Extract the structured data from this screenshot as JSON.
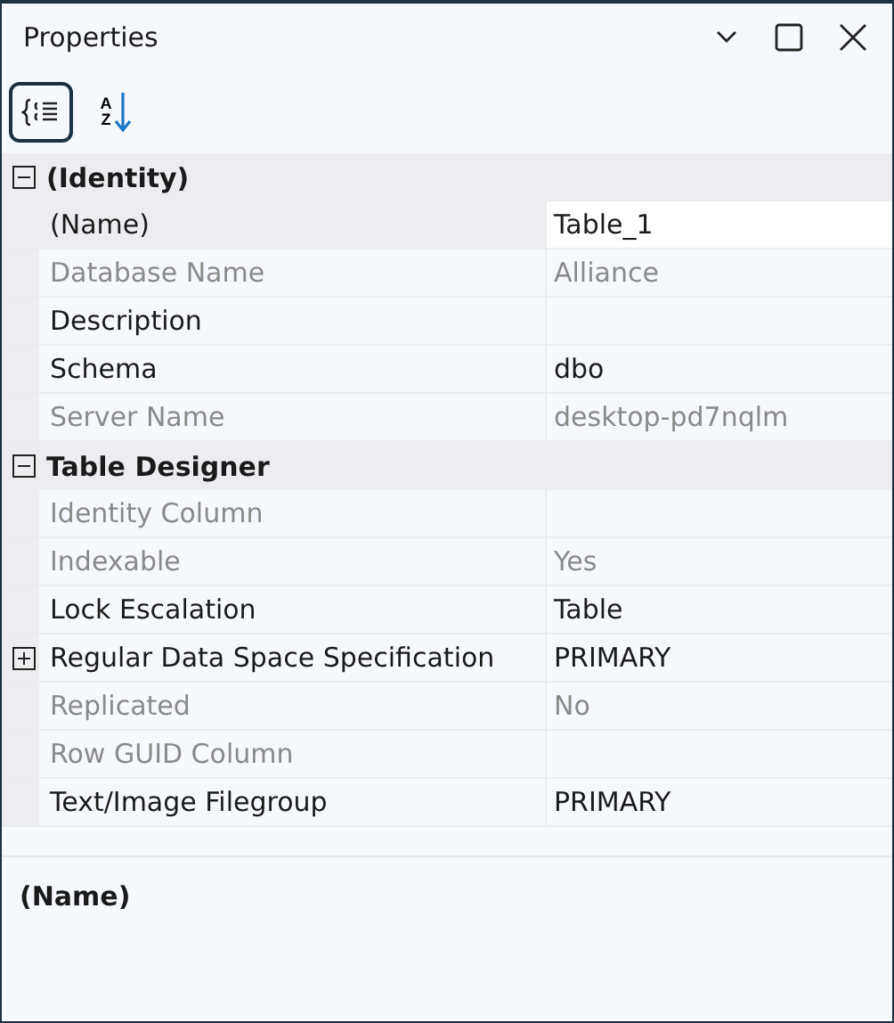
{
  "window": {
    "title": "Properties"
  },
  "toolbar": [
    {
      "kind": "categorized",
      "selected": true
    },
    {
      "kind": "alphabetical",
      "selected": false,
      "letters": [
        "A",
        "Z"
      ]
    }
  ],
  "categories": [
    {
      "name": "(Identity)",
      "expanded": true,
      "properties": [
        {
          "kind": "plain",
          "name": "(Name)",
          "value": "Table_1",
          "disabled": false,
          "selected": true
        },
        {
          "kind": "plain",
          "name": "Database Name",
          "value": "Alliance",
          "disabled": true,
          "selected": false
        },
        {
          "kind": "plain",
          "name": "Description",
          "disabled": false,
          "selected": false
        },
        {
          "kind": "plain",
          "name": "Schema",
          "value": "dbo",
          "disabled": false,
          "selected": false
        },
        {
          "kind": "plain",
          "name": "Server Name",
          "value": "desktop-pd7nqlm",
          "disabled": true,
          "selected": false
        }
      ]
    },
    {
      "name": "Table Designer",
      "expanded": true,
      "properties": [
        {
          "kind": "plain",
          "name": "Identity Column",
          "disabled": true,
          "selected": false
        },
        {
          "kind": "plain",
          "name": "Indexable",
          "value": "Yes",
          "disabled": true,
          "selected": false
        },
        {
          "kind": "plain",
          "name": "Lock Escalation",
          "value": "Table",
          "disabled": false,
          "selected": false
        },
        {
          "kind": "group",
          "name": "Regular Data Space Specification",
          "value": "PRIMARY",
          "disabled": false,
          "selected": false,
          "expanded": false
        },
        {
          "kind": "plain",
          "name": "Replicated",
          "value": "No",
          "disabled": true,
          "selected": false
        },
        {
          "kind": "plain",
          "name": "Row GUID Column",
          "disabled": true,
          "selected": false
        },
        {
          "kind": "plain",
          "name": "Text/Image Filegroup",
          "value": "PRIMARY",
          "disabled": false,
          "selected": false
        }
      ]
    }
  ],
  "description": {
    "title": "(Name)"
  }
}
